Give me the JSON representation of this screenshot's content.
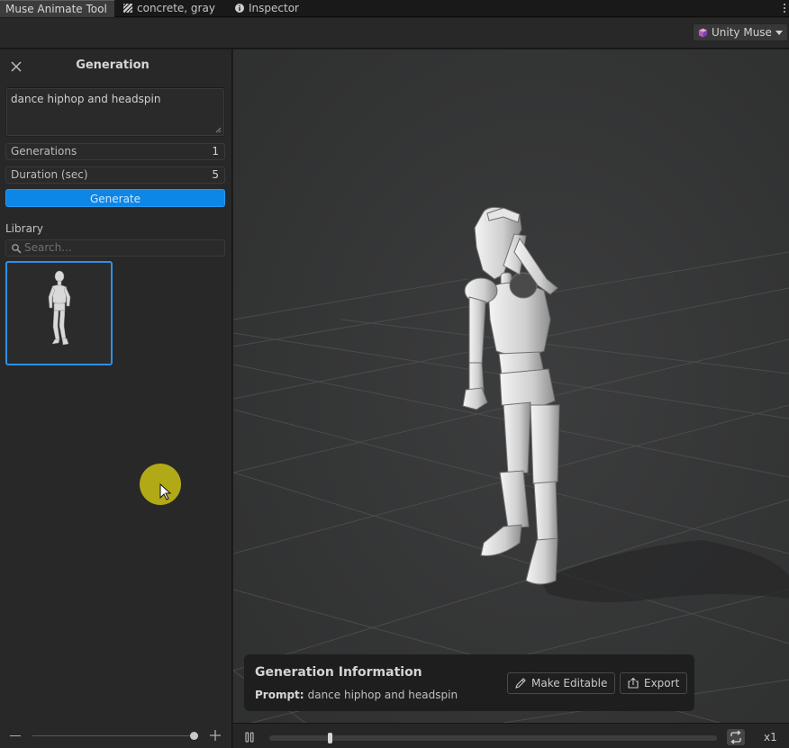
{
  "tabs": [
    {
      "label": "Muse Animate Tool",
      "icon": "none",
      "active": true
    },
    {
      "label": "concrete, gray",
      "icon": "material-stripes-icon",
      "active": false
    },
    {
      "label": "Inspector",
      "icon": "info-icon",
      "active": false
    }
  ],
  "toolbar": {
    "muse_label": "Unity Muse"
  },
  "generation": {
    "title": "Generation",
    "prompt": "dance hiphop and headspin",
    "fields": {
      "generations_label": "Generations",
      "generations_value": "1",
      "duration_label": "Duration (sec)",
      "duration_value": "5"
    },
    "generate_label": "Generate"
  },
  "library": {
    "label": "Library",
    "search_placeholder": "Search..."
  },
  "info_card": {
    "title": "Generation Information",
    "prompt_label": "Prompt:",
    "prompt_value": "dance hiphop and headspin",
    "make_editable_label": "Make Editable",
    "export_label": "Export"
  },
  "timeline": {
    "speed_label": "x1",
    "playhead_fraction": 0.135
  },
  "colors": {
    "accent": "#0e86e5",
    "selection": "#2f8fe8",
    "cursor_highlight": "#b8b015",
    "viewport_bg": "#353637"
  }
}
